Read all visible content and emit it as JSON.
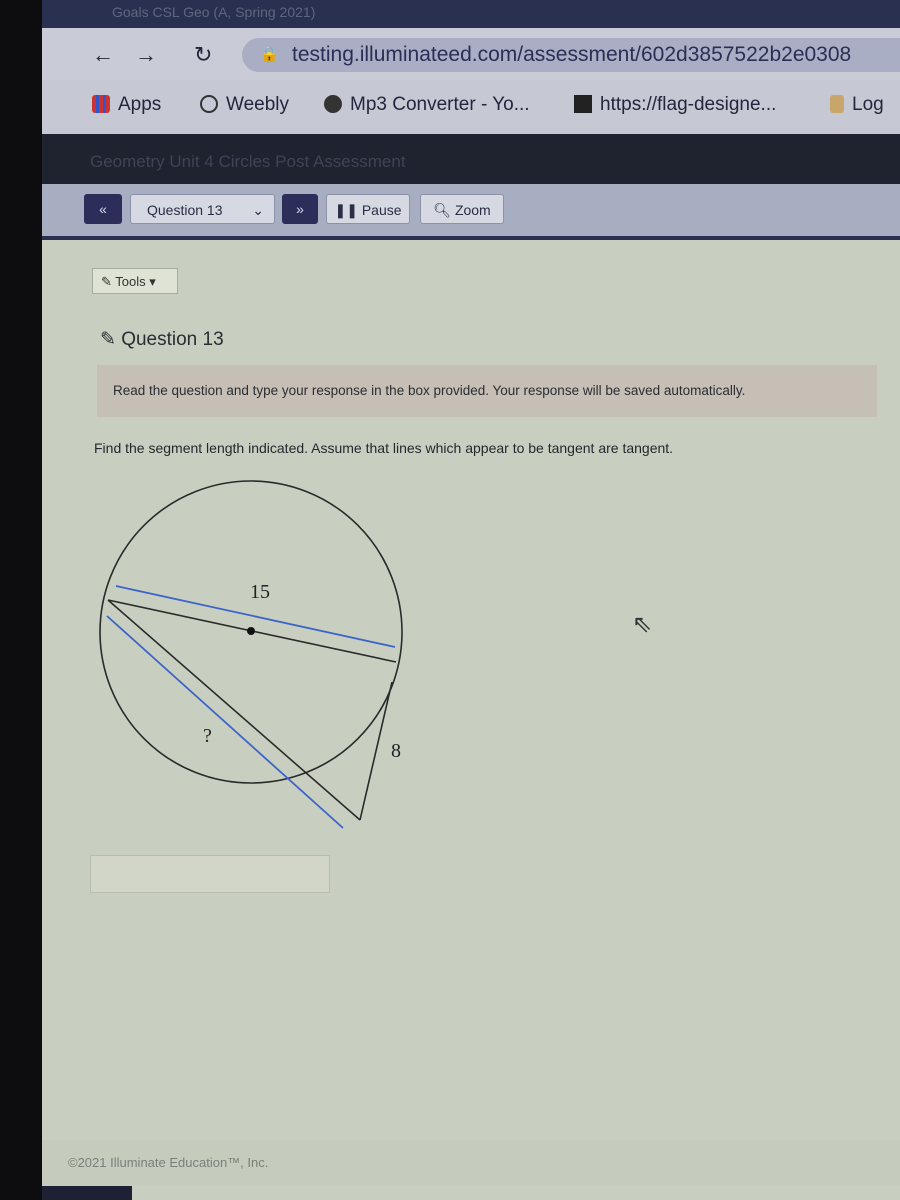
{
  "browser": {
    "tab_title": "Goals CSL Geo (A, Spring 2021)",
    "url": "testing.illuminateed.com/assessment/602d3857522b2e0308",
    "bookmarks": [
      {
        "label": "Apps",
        "icon": "apps-grid-icon"
      },
      {
        "label": "Weebly",
        "icon": "weebly-icon"
      },
      {
        "label": "Mp3 Converter - Yo...",
        "icon": "film-reel-icon"
      },
      {
        "label": "https://flag-designe...",
        "icon": "flag-icon"
      },
      {
        "label": "Log",
        "icon": "palm-tree-icon"
      }
    ]
  },
  "app": {
    "title": "Geometry Unit 4 Circles Post Assessment",
    "toolbar": {
      "prev": "«",
      "question_select": "Question 13",
      "next": "»",
      "pause": "Pause",
      "zoom": "Zoom"
    },
    "tools_label": "Tools",
    "question_heading": "Question 13",
    "instructions": "Read the question and type your response in the box provided. Your response will be saved automatically.",
    "prompt": "Find the segment length indicated. Assume that lines which appear to be tangent are tangent.",
    "diagram": {
      "label_diameter": "15",
      "label_unknown": "?",
      "label_tangent": "8",
      "line_color": "#2a2a2a",
      "measure_color": "#3a64c8"
    },
    "answer_value": "",
    "footer": "©2021 Illuminate Education™, Inc."
  }
}
